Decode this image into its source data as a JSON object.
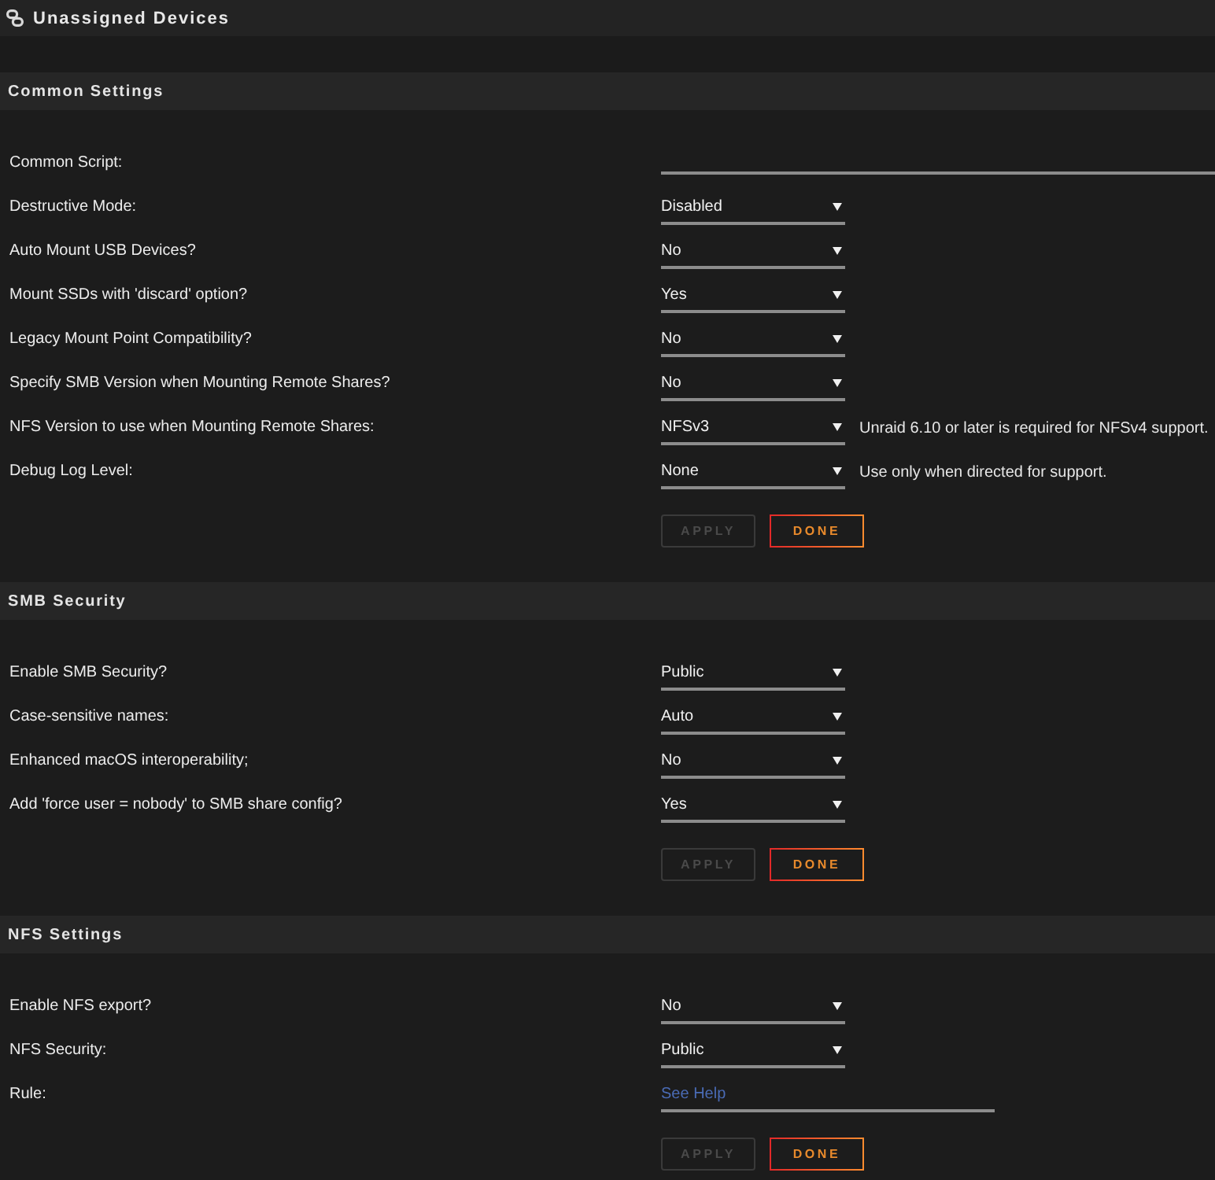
{
  "title": "Unassigned Devices",
  "sections": [
    {
      "title": "Common Settings",
      "settings": [
        {
          "label": "Common Script:",
          "kind": "longtext"
        },
        {
          "label": "Destructive Mode:",
          "kind": "select",
          "value": "Disabled"
        },
        {
          "label": "Auto Mount USB Devices?",
          "kind": "select",
          "value": "No"
        },
        {
          "label": "Mount SSDs with 'discard' option?",
          "kind": "select",
          "value": "Yes"
        },
        {
          "label": "Legacy Mount Point Compatibility?",
          "kind": "select",
          "value": "No"
        },
        {
          "label": "Specify SMB Version when Mounting Remote Shares?",
          "kind": "select",
          "value": "No"
        },
        {
          "label": "NFS Version to use when Mounting Remote Shares:",
          "kind": "select",
          "value": "NFSv3",
          "note": "Unraid 6.10 or later is required for NFSv4 support."
        },
        {
          "label": "Debug Log Level:",
          "kind": "select",
          "value": "None",
          "note": "Use only when directed for support."
        }
      ],
      "buttons": [
        {
          "label": "APPLY",
          "disabled": true
        },
        {
          "label": "DONE",
          "disabled": false
        }
      ]
    },
    {
      "title": "SMB Security",
      "settings": [
        {
          "label": "Enable SMB Security?",
          "kind": "select",
          "value": "Public"
        },
        {
          "label": "Case-sensitive names:",
          "kind": "select",
          "value": "Auto"
        },
        {
          "label": "Enhanced macOS interoperability;",
          "kind": "select",
          "value": "No"
        },
        {
          "label": "Add 'force user = nobody' to SMB share config?",
          "kind": "select",
          "value": "Yes"
        }
      ],
      "buttons": [
        {
          "label": "APPLY",
          "disabled": true
        },
        {
          "label": "DONE",
          "disabled": false
        }
      ]
    },
    {
      "title": "NFS Settings",
      "settings": [
        {
          "label": "Enable NFS export?",
          "kind": "select",
          "value": "No"
        },
        {
          "label": "NFS Security:",
          "kind": "select",
          "value": "Public"
        },
        {
          "label": "Rule:",
          "kind": "text",
          "placeholder": "See Help"
        }
      ],
      "buttons": [
        {
          "label": "APPLY",
          "disabled": true
        },
        {
          "label": "DONE",
          "disabled": false
        }
      ]
    }
  ]
}
